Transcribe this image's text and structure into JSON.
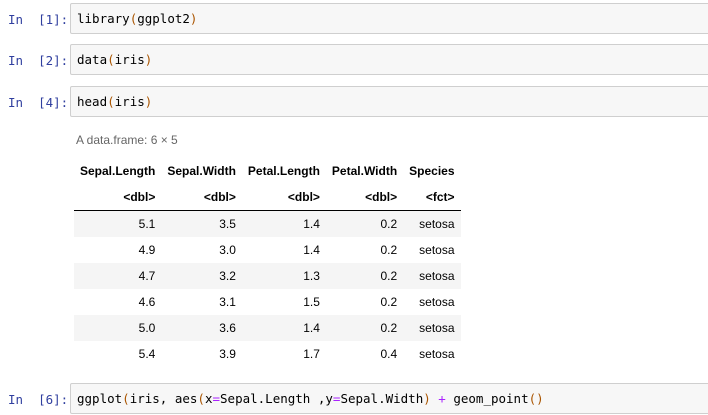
{
  "cells": [
    {
      "prompt": "In  [1]:",
      "code": [
        {
          "t": "library",
          "c": "fn"
        },
        {
          "t": "(",
          "c": "paren"
        },
        {
          "t": "ggplot2",
          "c": "fn"
        },
        {
          "t": ")",
          "c": "paren"
        }
      ]
    },
    {
      "prompt": "In  [2]:",
      "code": [
        {
          "t": "data",
          "c": "fn"
        },
        {
          "t": "(",
          "c": "paren"
        },
        {
          "t": "iris",
          "c": "fn"
        },
        {
          "t": ")",
          "c": "paren"
        }
      ]
    },
    {
      "prompt": "In  [4]:",
      "code": [
        {
          "t": "head",
          "c": "fn"
        },
        {
          "t": "(",
          "c": "paren"
        },
        {
          "t": "iris",
          "c": "fn"
        },
        {
          "t": ")",
          "c": "paren"
        }
      ]
    },
    {
      "prompt": "In  [6]:",
      "code": [
        {
          "t": "ggplot",
          "c": "fn"
        },
        {
          "t": "(",
          "c": "paren"
        },
        {
          "t": "iris, aes",
          "c": "fn"
        },
        {
          "t": "(",
          "c": "paren"
        },
        {
          "t": "x",
          "c": "fn"
        },
        {
          "t": "=",
          "c": "eq"
        },
        {
          "t": "Sepal.Length ,y",
          "c": "fn"
        },
        {
          "t": "=",
          "c": "eq"
        },
        {
          "t": "Sepal.Width",
          "c": "fn"
        },
        {
          "t": ")",
          "c": "paren"
        },
        {
          "t": " ",
          "c": "fn"
        },
        {
          "t": "+",
          "c": "op"
        },
        {
          "t": " geom_point",
          "c": "fn"
        },
        {
          "t": "()",
          "c": "paren"
        }
      ]
    }
  ],
  "output": {
    "caption": "A data.frame: 6 × 5",
    "columns": [
      "Sepal.Length",
      "Sepal.Width",
      "Petal.Length",
      "Petal.Width",
      "Species"
    ],
    "types": [
      "<dbl>",
      "<dbl>",
      "<dbl>",
      "<dbl>",
      "<fct>"
    ],
    "rows": [
      [
        "5.1",
        "3.5",
        "1.4",
        "0.2",
        "setosa"
      ],
      [
        "4.9",
        "3.0",
        "1.4",
        "0.2",
        "setosa"
      ],
      [
        "4.7",
        "3.2",
        "1.3",
        "0.2",
        "setosa"
      ],
      [
        "4.6",
        "3.1",
        "1.5",
        "0.2",
        "setosa"
      ],
      [
        "5.0",
        "3.6",
        "1.4",
        "0.2",
        "setosa"
      ],
      [
        "5.4",
        "3.9",
        "1.7",
        "0.4",
        "setosa"
      ]
    ]
  }
}
